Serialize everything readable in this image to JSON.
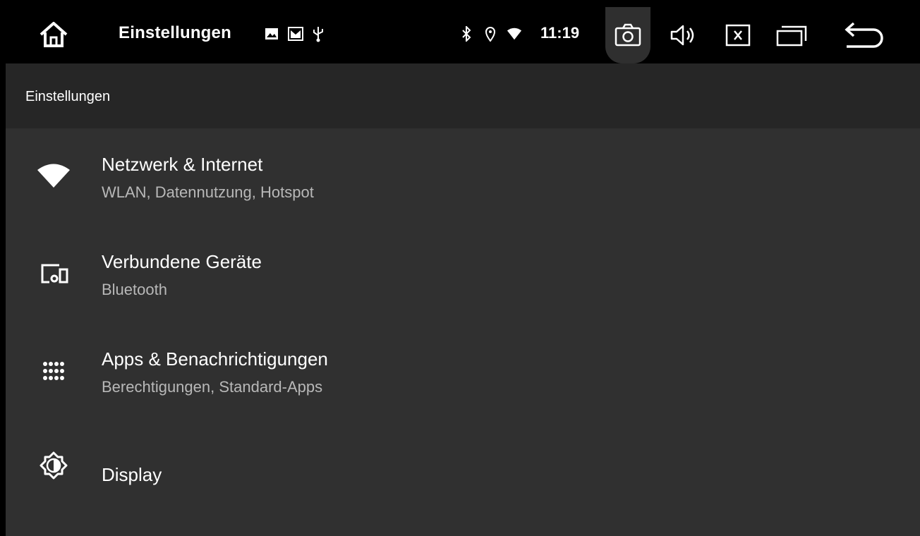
{
  "statusbar": {
    "title": "Einstellungen",
    "time": "11:19",
    "notification_icons": [
      "image-icon",
      "gallery-icon",
      "usb-icon"
    ],
    "status_icons": [
      "bluetooth-icon",
      "location-icon",
      "wifi-icon"
    ],
    "nav_buttons": [
      "screenshot-icon",
      "volume-icon",
      "close-app-icon",
      "recent-apps-icon",
      "back-icon"
    ]
  },
  "appbar": {
    "title": "Einstellungen"
  },
  "settings": {
    "items": [
      {
        "icon": "wifi-icon",
        "title": "Netzwerk & Internet",
        "subtitle": "WLAN, Datennutzung, Hotspot"
      },
      {
        "icon": "devices-icon",
        "title": "Verbundene Geräte",
        "subtitle": "Bluetooth"
      },
      {
        "icon": "apps-grid-icon",
        "title": "Apps & Benachrichtigungen",
        "subtitle": "Berechtigungen, Standard-Apps"
      },
      {
        "icon": "brightness-icon",
        "title": "Display"
      }
    ]
  }
}
